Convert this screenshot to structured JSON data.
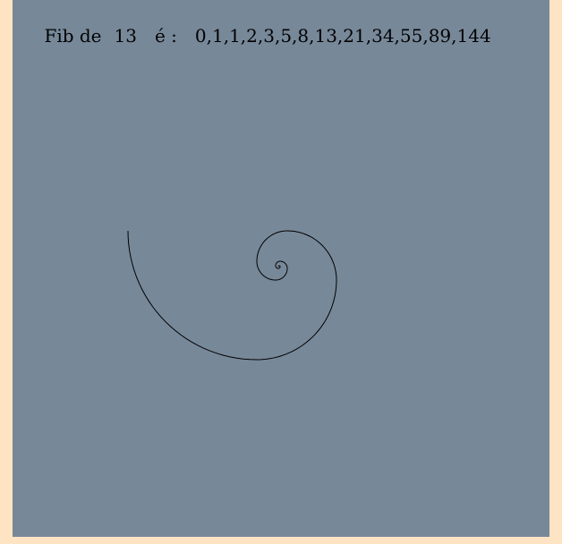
{
  "header": {
    "prefix": "Fib de",
    "n": "13",
    "connector": "é :",
    "sequence": "0,1,1,2,3,5,8,13,21,34,55,89,144"
  },
  "colors": {
    "page_background": "#ffe4c4",
    "canvas_background": "#778899",
    "spiral_stroke": "#000000"
  }
}
